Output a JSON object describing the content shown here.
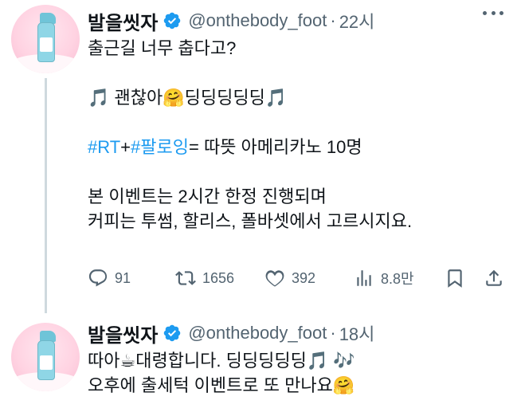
{
  "tweets": [
    {
      "name": "발을씻자",
      "handle": "@onthebody_foot",
      "separator": "·",
      "time": "22시",
      "lines": {
        "l1": "출근길 너무 춥다고?",
        "l2_a": "🎵 괜찮아",
        "l2_emoji": "🤗",
        "l2_b": " 딩딩딩딩딩🎵",
        "l3_tag1": "#RT",
        "l3_plus": " + ",
        "l3_tag2": "#팔로잉",
        "l3_rest": " = 따뜻 아메리카노 10명",
        "l4": "본 이벤트는 2시간 한정 진행되며",
        "l5": "커피는 투썸, 할리스, 폴바셋에서 고르시지요."
      },
      "stats": {
        "replies": "91",
        "retweets": "1656",
        "likes": "392",
        "views": "8.8만"
      }
    },
    {
      "name": "발을씻자",
      "handle": "@onthebody_foot",
      "separator": "·",
      "time": "18시",
      "lines": {
        "l1_a": "따아",
        "l1_emoji": "☕",
        "l1_b": " 대령합니다. 딩딩딩딩딩",
        "l1_notes": "🎵 🎶",
        "l2_a": "오후에 출세턱 이벤트로 또 만나요",
        "l2_emoji": "🤗"
      }
    }
  ],
  "icons": {
    "verified": "verified-badge-icon",
    "reply": "reply-icon",
    "retweet": "retweet-icon",
    "like": "heart-icon",
    "views": "views-icon",
    "bookmark": "bookmark-icon",
    "share": "share-icon",
    "more": "more-icon"
  },
  "colors": {
    "accent": "#1d9bf0",
    "text": "#0f1419",
    "muted": "#536471",
    "thread_line": "#cfd9de"
  }
}
